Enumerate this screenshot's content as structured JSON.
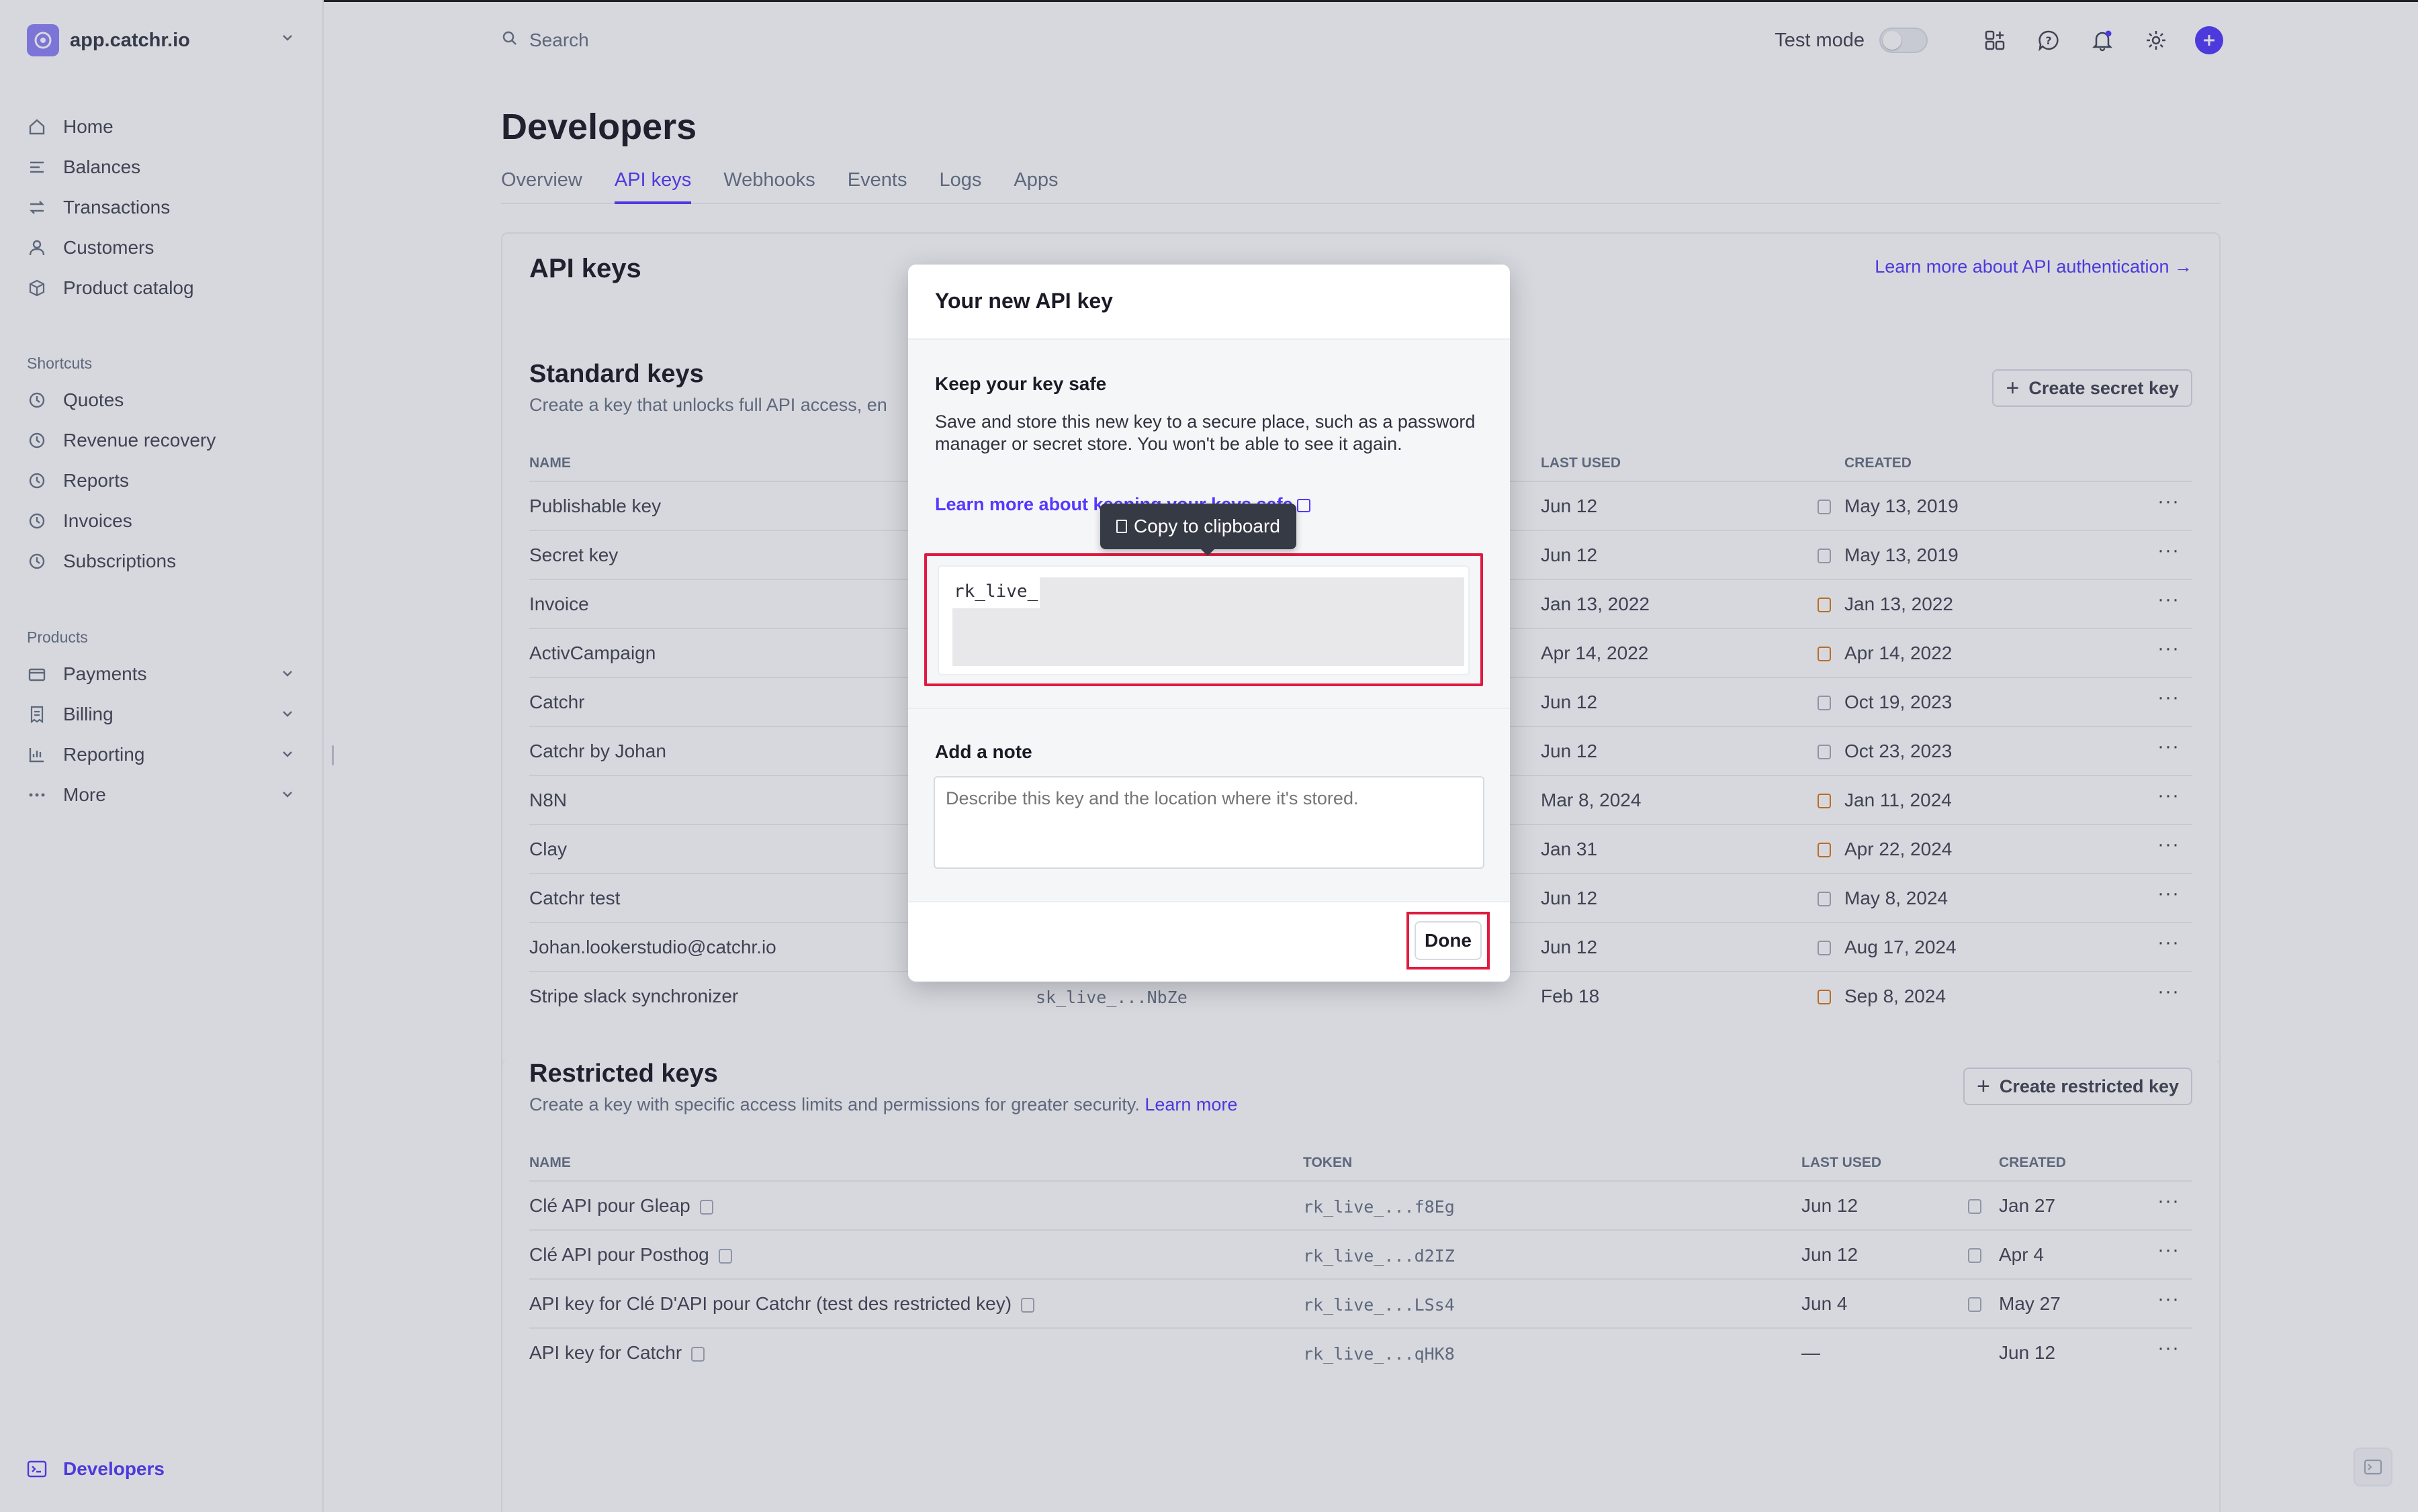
{
  "account": {
    "name": "app.catchr.io"
  },
  "sidebar": {
    "main": [
      {
        "label": "Home",
        "icon": "home-icon"
      },
      {
        "label": "Balances",
        "icon": "balances-icon"
      },
      {
        "label": "Transactions",
        "icon": "transactions-icon"
      },
      {
        "label": "Customers",
        "icon": "customers-icon"
      },
      {
        "label": "Product catalog",
        "icon": "product-catalog-icon"
      }
    ],
    "shortcuts_title": "Shortcuts",
    "shortcuts": [
      {
        "label": "Quotes"
      },
      {
        "label": "Revenue recovery"
      },
      {
        "label": "Reports"
      },
      {
        "label": "Invoices"
      },
      {
        "label": "Subscriptions"
      }
    ],
    "products_title": "Products",
    "products": [
      {
        "label": "Payments"
      },
      {
        "label": "Billing"
      },
      {
        "label": "Reporting"
      },
      {
        "label": "More"
      }
    ],
    "developers": "Developers"
  },
  "topbar": {
    "search_placeholder": "Search",
    "test_mode": "Test mode"
  },
  "page": {
    "title": "Developers",
    "tabs": [
      "Overview",
      "API keys",
      "Webhooks",
      "Events",
      "Logs",
      "Apps"
    ],
    "active_tab": "API keys"
  },
  "api_keys_card": {
    "title": "API keys",
    "link": "Learn more about API authentication →"
  },
  "standard_keys": {
    "title": "Standard keys",
    "subtitle": "Create a key that unlocks full API access, en",
    "create_button": "Create secret key",
    "headers": {
      "name": "NAME",
      "last_used": "LAST USED",
      "created": "CREATED"
    },
    "rows": [
      {
        "name": "Publishable key",
        "token": "",
        "last_used": "Jun 12",
        "created": "May 13, 2019",
        "warn": false
      },
      {
        "name": "Secret key",
        "token": "",
        "last_used": "Jun 12",
        "created": "May 13, 2019",
        "warn": false
      },
      {
        "name": "Invoice",
        "token": "",
        "last_used": "Jan 13, 2022",
        "created": "Jan 13, 2022",
        "warn": true
      },
      {
        "name": "ActivCampaign",
        "token": "",
        "last_used": "Apr 14, 2022",
        "created": "Apr 14, 2022",
        "warn": true
      },
      {
        "name": "Catchr",
        "token": "",
        "last_used": "Jun 12",
        "created": "Oct 19, 2023",
        "warn": false
      },
      {
        "name": "Catchr by Johan",
        "token": "",
        "last_used": "Jun 12",
        "created": "Oct 23, 2023",
        "warn": false
      },
      {
        "name": "N8N",
        "token": "",
        "last_used": "Mar 8, 2024",
        "created": "Jan 11, 2024",
        "warn": true
      },
      {
        "name": "Clay",
        "token": "",
        "last_used": "Jan 31",
        "created": "Apr 22, 2024",
        "warn": true
      },
      {
        "name": "Catchr test",
        "token": "",
        "last_used": "Jun 12",
        "created": "May 8, 2024",
        "warn": false
      },
      {
        "name": "Johan.lookerstudio@catchr.io",
        "token": "",
        "last_used": "Jun 12",
        "created": "Aug 17, 2024",
        "warn": false
      },
      {
        "name": "Stripe slack synchronizer",
        "token": "sk_live_...NbZe",
        "last_used": "Feb 18",
        "created": "Sep 8, 2024",
        "warn": true
      }
    ]
  },
  "restricted_keys": {
    "title": "Restricted keys",
    "subtitle": "Create a key with specific access limits and permissions for greater security.",
    "subtitle_link": "Learn more",
    "create_button": "Create restricted key",
    "headers": {
      "name": "NAME",
      "token": "TOKEN",
      "last_used": "LAST USED",
      "created": "CREATED"
    },
    "rows": [
      {
        "name": "Clé API pour Gleap",
        "token": "rk_live_...f8Eg",
        "last_used": "Jun 12",
        "created": "Jan 27"
      },
      {
        "name": "Clé API pour Posthog",
        "token": "rk_live_...d2IZ",
        "last_used": "Jun 12",
        "created": "Apr 4"
      },
      {
        "name": "API key for Clé D'API pour Catchr (test des restricted key)",
        "token": "rk_live_...LSs4",
        "last_used": "Jun 4",
        "created": "May 27"
      },
      {
        "name": "API key for Catchr",
        "token": "rk_live_...qHK8",
        "last_used": "—",
        "created": "Jun 12"
      }
    ]
  },
  "modal": {
    "title": "Your new API key",
    "safe_title": "Keep your key safe",
    "safe_text": "Save and store this new key to a secure place, such as a password manager or secret store. You won't be able to see it again.",
    "learn_link": "Learn more about keeping your keys safe",
    "tooltip": "Copy to clipboard",
    "key_value": "rk_live_",
    "note_title": "Add a note",
    "note_placeholder": "Describe this key and the location where it's stored.",
    "done": "Done"
  },
  "colors": {
    "accent": "#533afd",
    "highlight": "#df1b41",
    "warning": "#d97917"
  }
}
